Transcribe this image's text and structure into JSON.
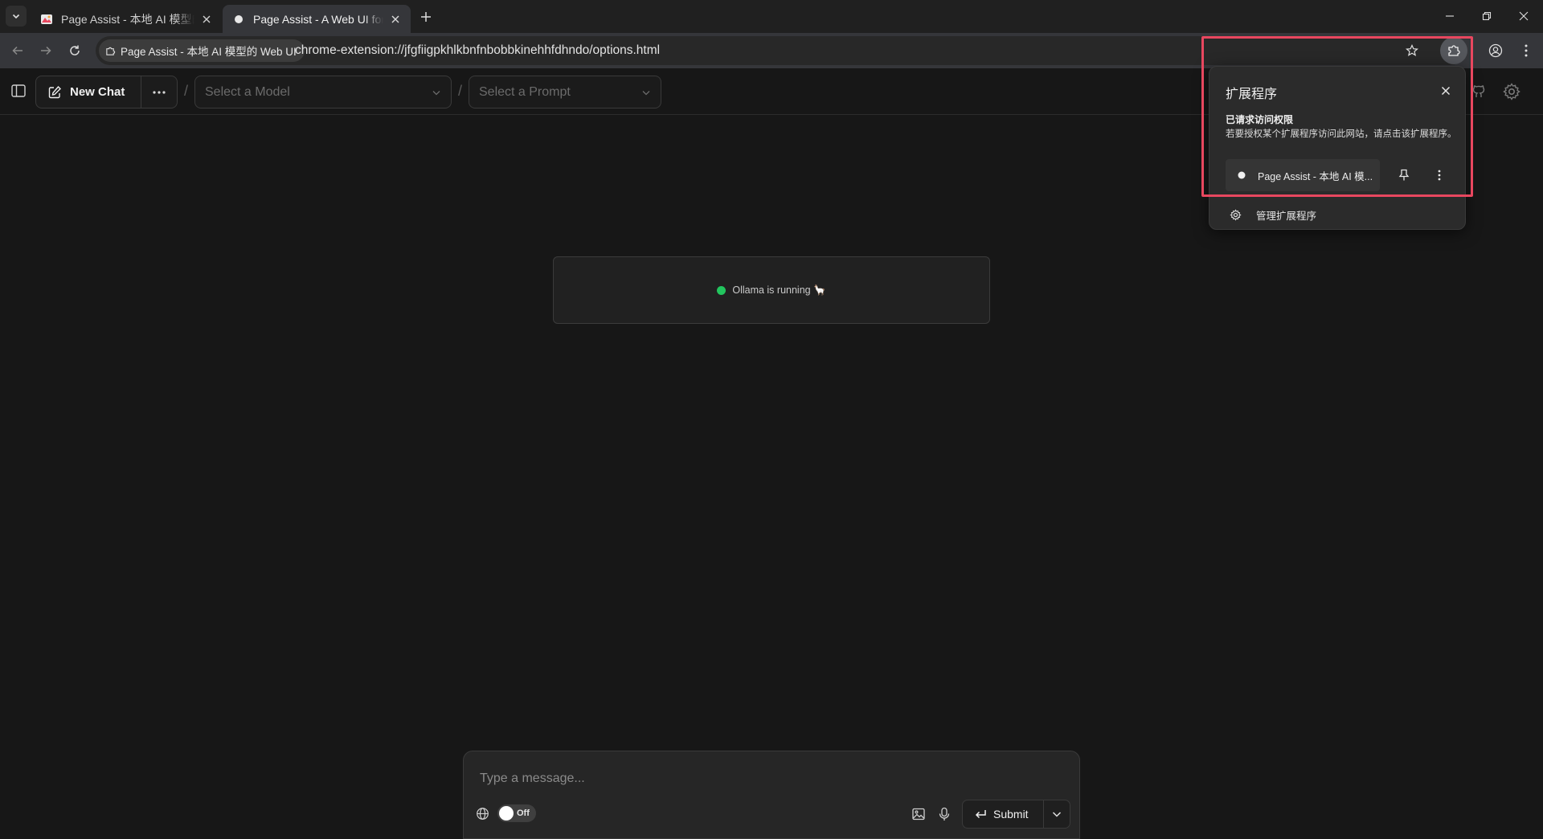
{
  "browser": {
    "tabs": [
      {
        "title": "Page Assist - 本地 AI 模型的 Web UI",
        "active": false
      },
      {
        "title": "Page Assist - A Web UI for Local AI Models",
        "active": true
      }
    ],
    "site_chip": "Page Assist - 本地 AI 模型的 Web UI",
    "url": "chrome-extension://jfgfiigpkhlkbnfnbobbkinehhfdhndo/options.html"
  },
  "header": {
    "new_chat_label": "New Chat",
    "model_select": {
      "placeholder": "Select a Model"
    },
    "prompt_select": {
      "placeholder": "Select a Prompt"
    },
    "separator": "/"
  },
  "status": {
    "text": "Ollama is running 🦙",
    "color": "#22c55e"
  },
  "composer": {
    "placeholder": "Type a message...",
    "toggle_label": "Off",
    "submit_label": "Submit"
  },
  "extensions_popup": {
    "title": "扩展程序",
    "section_title": "已请求访问权限",
    "description": "若要授权某个扩展程序访问此网站，请点击该扩展程序。",
    "item_name": "Page Assist - 本地 AI 模...",
    "manage_label": "管理扩展程序",
    "highlight_color": "#e8475f"
  }
}
